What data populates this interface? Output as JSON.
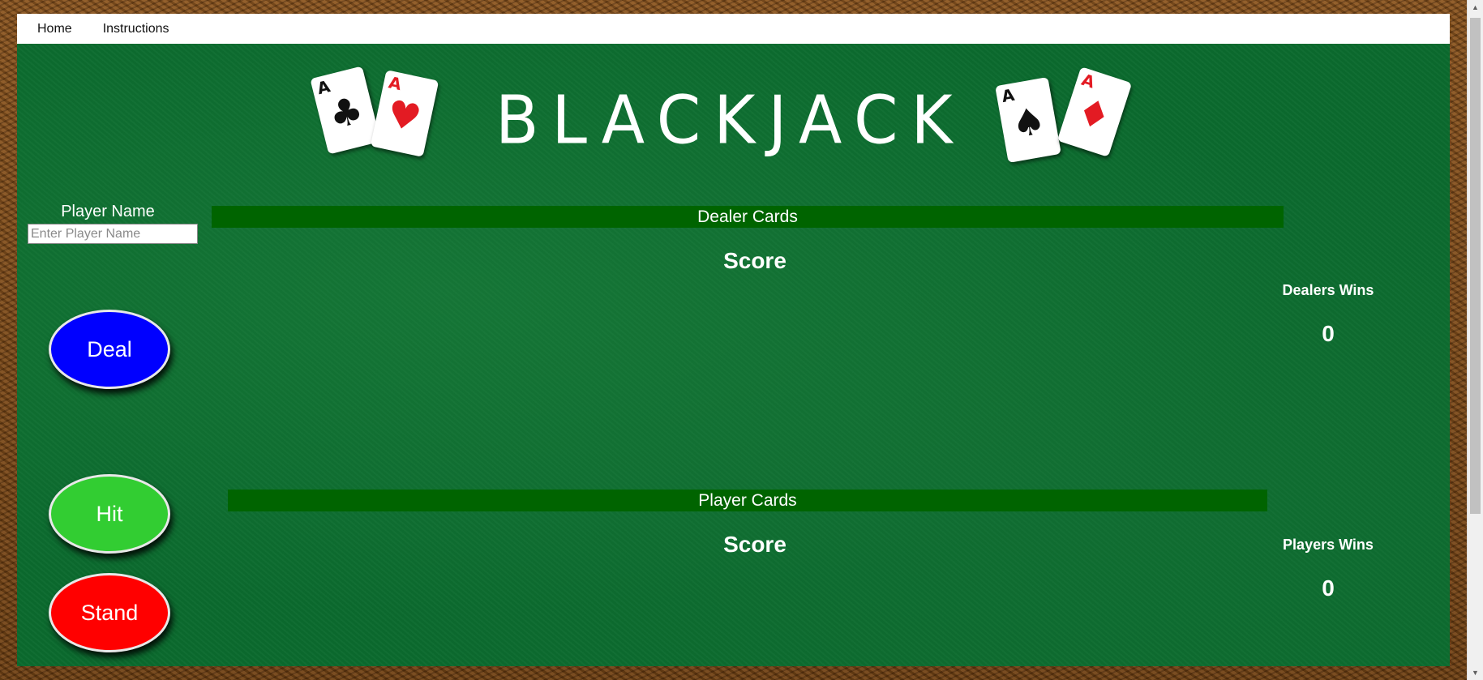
{
  "nav": {
    "home": "Home",
    "instructions": "Instructions"
  },
  "logo": {
    "title": "BLACKJACK",
    "cards": [
      {
        "rank": "A",
        "suit": "♣",
        "color": "black"
      },
      {
        "rank": "A",
        "suit": "♥",
        "color": "red"
      },
      {
        "rank": "A",
        "suit": "♠",
        "color": "black"
      },
      {
        "rank": "A",
        "suit": "♦",
        "color": "red"
      }
    ]
  },
  "player": {
    "name_label": "Player Name",
    "name_placeholder": "Enter Player Name"
  },
  "dealer_section": {
    "title": "Dealer Cards",
    "score_label": "Score",
    "wins_label": "Dealers Wins",
    "wins_value": "0"
  },
  "player_section": {
    "title": "Player Cards",
    "score_label": "Score",
    "wins_label": "Players Wins",
    "wins_value": "0"
  },
  "buttons": {
    "deal": "Deal",
    "hit": "Hit",
    "stand": "Stand"
  },
  "colors": {
    "felt": "#0b6b2e",
    "section_bar": "#006400",
    "deal": "#0000ff",
    "hit": "#32cd32",
    "stand": "#ff0000"
  }
}
